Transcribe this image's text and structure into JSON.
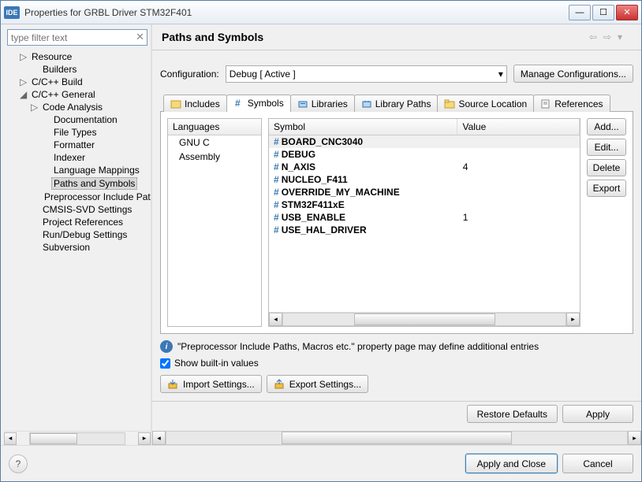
{
  "window": {
    "title": "Properties for GRBL Driver STM32F401"
  },
  "filter": {
    "placeholder": "type filter text"
  },
  "tree": [
    {
      "label": "Resource",
      "indent": 1,
      "tw": "▷"
    },
    {
      "label": "Builders",
      "indent": 2,
      "tw": ""
    },
    {
      "label": "C/C++ Build",
      "indent": 1,
      "tw": "▷"
    },
    {
      "label": "C/C++ General",
      "indent": 1,
      "tw": "◢"
    },
    {
      "label": "Code Analysis",
      "indent": 2,
      "tw": "▷"
    },
    {
      "label": "Documentation",
      "indent": 3,
      "tw": ""
    },
    {
      "label": "File Types",
      "indent": 3,
      "tw": ""
    },
    {
      "label": "Formatter",
      "indent": 3,
      "tw": ""
    },
    {
      "label": "Indexer",
      "indent": 3,
      "tw": ""
    },
    {
      "label": "Language Mappings",
      "indent": 3,
      "tw": ""
    },
    {
      "label": "Paths and Symbols",
      "indent": 3,
      "tw": "",
      "selected": true
    },
    {
      "label": "Preprocessor Include Pat",
      "indent": 3,
      "tw": ""
    },
    {
      "label": "CMSIS-SVD Settings",
      "indent": 2,
      "tw": ""
    },
    {
      "label": "Project References",
      "indent": 2,
      "tw": ""
    },
    {
      "label": "Run/Debug Settings",
      "indent": 2,
      "tw": ""
    },
    {
      "label": "Subversion",
      "indent": 2,
      "tw": ""
    }
  ],
  "page": {
    "title": "Paths and Symbols"
  },
  "config": {
    "label": "Configuration:",
    "value": "Debug  [ Active ]",
    "manage": "Manage Configurations..."
  },
  "tabs": [
    "Includes",
    "Symbols",
    "Libraries",
    "Library Paths",
    "Source Location",
    "References"
  ],
  "activeTab": 1,
  "langPanel": {
    "header": "Languages",
    "items": [
      "GNU C",
      "Assembly"
    ]
  },
  "symTable": {
    "headers": {
      "symbol": "Symbol",
      "value": "Value"
    },
    "rows": [
      {
        "sym": "BOARD_CNC3040",
        "val": "",
        "sel": true
      },
      {
        "sym": "DEBUG",
        "val": ""
      },
      {
        "sym": "N_AXIS",
        "val": "4"
      },
      {
        "sym": "NUCLEO_F411",
        "val": ""
      },
      {
        "sym": "OVERRIDE_MY_MACHINE",
        "val": ""
      },
      {
        "sym": "STM32F411xE",
        "val": ""
      },
      {
        "sym": "USB_ENABLE",
        "val": "1"
      },
      {
        "sym": "USE_HAL_DRIVER",
        "val": ""
      }
    ]
  },
  "sideBtns": {
    "add": "Add...",
    "edit": "Edit...",
    "delete": "Delete",
    "export": "Export"
  },
  "info": "\"Preprocessor Include Paths, Macros etc.\" property page may define additional entries",
  "showBuiltIn": {
    "label": "Show built-in values",
    "checked": true
  },
  "settingsBtns": {
    "import": "Import Settings...",
    "export": "Export Settings..."
  },
  "bottomBtns": {
    "restore": "Restore Defaults",
    "apply": "Apply"
  },
  "footerBtns": {
    "applyClose": "Apply and Close",
    "cancel": "Cancel"
  }
}
